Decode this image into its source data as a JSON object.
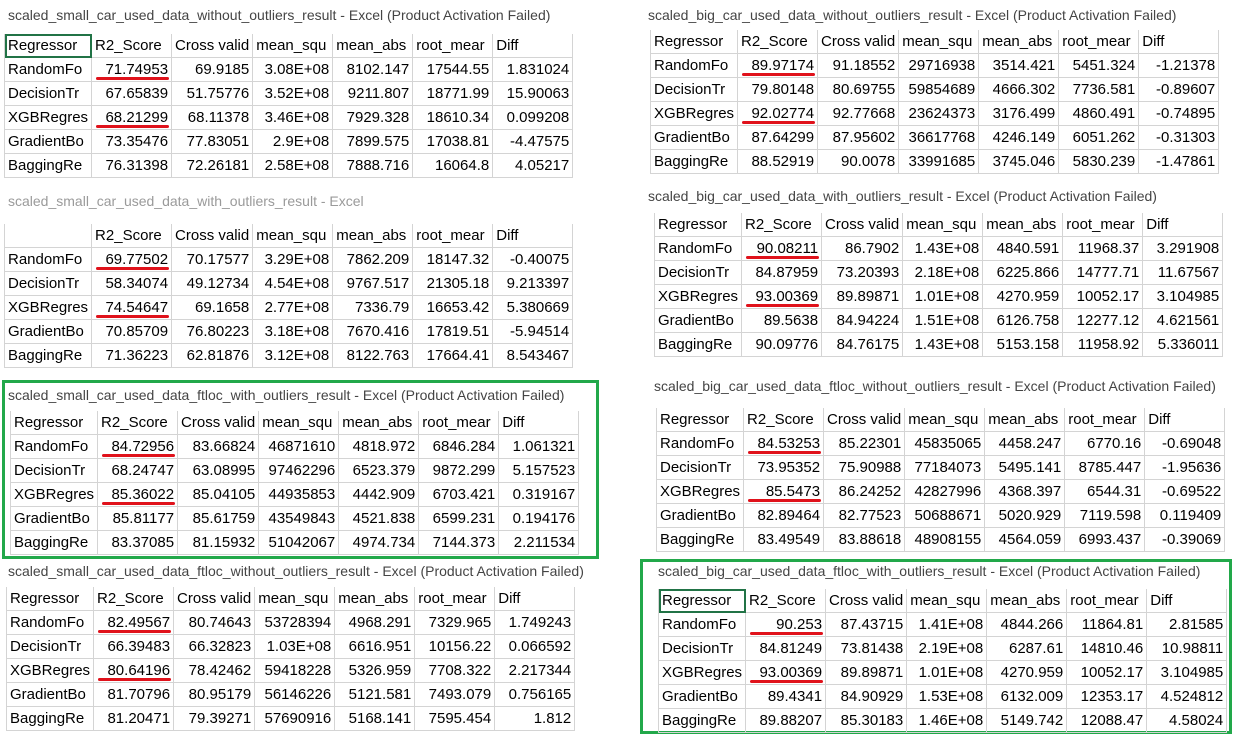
{
  "headers": [
    "Regressor",
    "R2_Score",
    "Cross valid",
    "mean_squ",
    "mean_abs",
    "root_mear",
    "Diff"
  ],
  "accent_underline_color": "#e0121b",
  "highlight_box_color": "#22a84a",
  "panels": {
    "p1": {
      "title": "scaled_small_car_used_data_without_outliers_result - Excel (Product Activation Failed)",
      "rows": [
        [
          "RandomFo",
          "71.74953",
          "69.9185",
          "3.08E+08",
          "8102.147",
          "17544.55",
          "1.831024"
        ],
        [
          "DecisionTr",
          "67.65839",
          "51.75776",
          "3.52E+08",
          "9211.807",
          "18771.99",
          "15.90063"
        ],
        [
          "XGBRegres",
          "68.21299",
          "68.11378",
          "3.46E+08",
          "7929.328",
          "18610.34",
          "0.099208"
        ],
        [
          "GradientBo",
          "73.35476",
          "77.83051",
          "2.9E+08",
          "7899.575",
          "17038.81",
          "-4.47575"
        ],
        [
          "BaggingRe",
          "76.31398",
          "72.26181",
          "2.58E+08",
          "7888.716",
          "16064.8",
          "4.05217"
        ]
      ]
    },
    "p2": {
      "title": "scaled_small_car_used_data_with_outliers_result - Excel",
      "rows": [
        [
          "RandomFo",
          "69.77502",
          "70.17577",
          "3.29E+08",
          "7862.209",
          "18147.32",
          "-0.40075"
        ],
        [
          "DecisionTr",
          "58.34074",
          "49.12734",
          "4.54E+08",
          "9767.517",
          "21305.18",
          "9.213397"
        ],
        [
          "XGBRegres",
          "74.54647",
          "69.1658",
          "2.77E+08",
          "7336.79",
          "16653.42",
          "5.380669"
        ],
        [
          "GradientBo",
          "70.85709",
          "76.80223",
          "3.18E+08",
          "7670.416",
          "17819.51",
          "-5.94514"
        ],
        [
          "BaggingRe",
          "71.36223",
          "62.81876",
          "3.12E+08",
          "8122.763",
          "17664.41",
          "8.543467"
        ]
      ]
    },
    "p3": {
      "title": "scaled_small_car_used_data_ftloc_with_outliers_result - Excel (Product Activation Failed)",
      "rows": [
        [
          "RandomFo",
          "84.72956",
          "83.66824",
          "46871610",
          "4818.972",
          "6846.284",
          "1.061321"
        ],
        [
          "DecisionTr",
          "68.24747",
          "63.08995",
          "97462296",
          "6523.379",
          "9872.299",
          "5.157523"
        ],
        [
          "XGBRegres",
          "85.36022",
          "85.04105",
          "44935853",
          "4442.909",
          "6703.421",
          "0.319167"
        ],
        [
          "GradientBo",
          "85.81177",
          "85.61759",
          "43549843",
          "4521.838",
          "6599.231",
          "0.194176"
        ],
        [
          "BaggingRe",
          "83.37085",
          "81.15932",
          "51042067",
          "4974.734",
          "7144.373",
          "2.211534"
        ]
      ]
    },
    "p4": {
      "title": "scaled_small_car_used_data_ftloc_without_outliers_result - Excel (Product Activation Failed)",
      "rows": [
        [
          "RandomFo",
          "82.49567",
          "80.74643",
          "53728394",
          "4968.291",
          "7329.965",
          "1.749243"
        ],
        [
          "DecisionTr",
          "66.39483",
          "66.32823",
          "1.03E+08",
          "6616.951",
          "10156.22",
          "0.066592"
        ],
        [
          "XGBRegres",
          "80.64196",
          "78.42462",
          "59418228",
          "5326.959",
          "7708.322",
          "2.217344"
        ],
        [
          "GradientBo",
          "81.70796",
          "80.95179",
          "56146226",
          "5121.581",
          "7493.079",
          "0.756165"
        ],
        [
          "BaggingRe",
          "81.20471",
          "79.39271",
          "57690916",
          "5168.141",
          "7595.454",
          "1.812"
        ]
      ]
    },
    "p5": {
      "title": "scaled_big_car_used_data_without_outliers_result - Excel (Product Activation Failed)",
      "rows": [
        [
          "RandomFo",
          "89.97174",
          "91.18552",
          "29716938",
          "3514.421",
          "5451.324",
          "-1.21378"
        ],
        [
          "DecisionTr",
          "79.80148",
          "80.69755",
          "59854689",
          "4666.302",
          "7736.581",
          "-0.89607"
        ],
        [
          "XGBRegres",
          "92.02774",
          "92.77668",
          "23624373",
          "3176.499",
          "4860.491",
          "-0.74895"
        ],
        [
          "GradientBo",
          "87.64299",
          "87.95602",
          "36617768",
          "4246.149",
          "6051.262",
          "-0.31303"
        ],
        [
          "BaggingRe",
          "88.52919",
          "90.0078",
          "33991685",
          "3745.046",
          "5830.239",
          "-1.47861"
        ]
      ]
    },
    "p6": {
      "title": "scaled_big_car_used_data_with_outliers_result - Excel (Product Activation Failed)",
      "rows": [
        [
          "RandomFo",
          "90.08211",
          "86.7902",
          "1.43E+08",
          "4840.591",
          "11968.37",
          "3.291908"
        ],
        [
          "DecisionTr",
          "84.87959",
          "73.20393",
          "2.18E+08",
          "6225.866",
          "14777.71",
          "11.67567"
        ],
        [
          "XGBRegres",
          "93.00369",
          "89.89871",
          "1.01E+08",
          "4270.959",
          "10052.17",
          "3.104985"
        ],
        [
          "GradientBo",
          "89.5638",
          "84.94224",
          "1.51E+08",
          "6126.758",
          "12277.12",
          "4.621561"
        ],
        [
          "BaggingRe",
          "90.09776",
          "84.76175",
          "1.43E+08",
          "5153.158",
          "11958.92",
          "5.336011"
        ]
      ]
    },
    "p7": {
      "title": "scaled_big_car_used_data_ftloc_without_outliers_result - Excel (Product Activation Failed)",
      "rows": [
        [
          "RandomFo",
          "84.53253",
          "85.22301",
          "45835065",
          "4458.247",
          "6770.16",
          "-0.69048"
        ],
        [
          "DecisionTr",
          "73.95352",
          "75.90988",
          "77184073",
          "5495.141",
          "8785.447",
          "-1.95636"
        ],
        [
          "XGBRegres",
          "85.5473",
          "86.24252",
          "42827996",
          "4368.397",
          "6544.31",
          "-0.69522"
        ],
        [
          "GradientBo",
          "82.89464",
          "82.77523",
          "50688671",
          "5020.929",
          "7119.598",
          "0.119409"
        ],
        [
          "BaggingRe",
          "83.49549",
          "83.88618",
          "48908155",
          "4564.059",
          "6993.437",
          "-0.39069"
        ]
      ]
    },
    "p8": {
      "title": "scaled_big_car_used_data_ftloc_with_outliers_result - Excel (Product Activation Failed)",
      "rows": [
        [
          "RandomFo",
          "90.253",
          "87.43715",
          "1.41E+08",
          "4844.266",
          "11864.81",
          "2.81585"
        ],
        [
          "DecisionTr",
          "84.81249",
          "73.81438",
          "2.19E+08",
          "6287.61",
          "14810.46",
          "10.98811"
        ],
        [
          "XGBRegres",
          "93.00369",
          "89.89871",
          "1.01E+08",
          "4270.959",
          "10052.17",
          "3.104985"
        ],
        [
          "GradientBo",
          "89.4341",
          "84.90929",
          "1.53E+08",
          "6132.009",
          "12353.17",
          "4.524812"
        ],
        [
          "BaggingRe",
          "89.88207",
          "85.30183",
          "1.46E+08",
          "5149.742",
          "12088.47",
          "4.58024"
        ]
      ]
    }
  }
}
